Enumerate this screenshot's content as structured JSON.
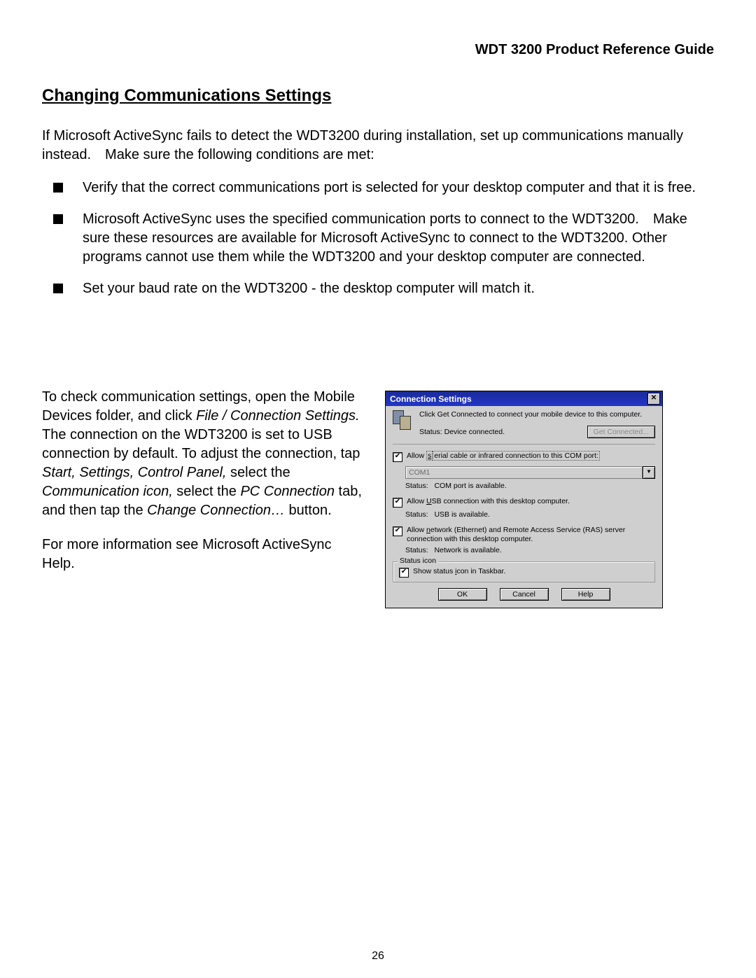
{
  "header": "WDT 3200 Product Reference Guide",
  "title": "Changing Communications Settings",
  "intro": "If Microsoft ActiveSync fails to detect the WDT3200 during installation, set up communications manually instead. Make sure the following conditions are met:",
  "bullets": [
    "Verify that the correct communications port is selected for your desktop computer and that it is free.",
    "Microsoft ActiveSync uses the specified communication ports to connect to the WDT3200. Make sure these resources are available for Microsoft ActiveSync to connect to the WDT3200. Other programs cannot use them while the WDT3200 and your desktop computer are connected.",
    "Set your baud rate on the WDT3200 - the desktop computer will match it."
  ],
  "left": {
    "p1_a": "To check communication settings, open the Mobile Devices folder, and click ",
    "p1_i1": "File / Connection Settings.",
    "p1_b": " The connection on the WDT3200 is set to USB connection by default. To adjust the connection, tap ",
    "p1_i2": "Start, Settings, Control Panel,",
    "p1_c": " select the ",
    "p1_i3": "Communication icon,",
    "p1_d": " select the ",
    "p1_i4": "PC Connection",
    "p1_e": " tab, and then tap the ",
    "p1_i5": "Change Connection…",
    "p1_f": " button.",
    "p2": "For more information see Microsoft ActiveSync Help."
  },
  "dialog": {
    "title": "Connection Settings",
    "close": "✕",
    "instr": "Click Get Connected to connect your mobile device to this computer.",
    "top_status_label": "Status:",
    "top_status_value": "Device connected.",
    "get_connected": "Get Connected...",
    "serial_a": "Allow ",
    "serial_u": "s",
    "serial_b": "erial cable or infrared connection to this COM port:",
    "com_value": "COM1",
    "com_status_label": "Status:",
    "com_status_value": "COM port is available.",
    "usb_a": "Allow ",
    "usb_u": "U",
    "usb_b": "SB connection with this desktop computer.",
    "usb_status_label": "Status:",
    "usb_status_value": "USB is available.",
    "net_a": "Allow ",
    "net_u": "n",
    "net_b": "etwork (Ethernet) and Remote Access Service (RAS) server connection with this desktop computer.",
    "net_status_label": "Status:",
    "net_status_value": "Network is available.",
    "group_legend": "Status icon",
    "show_a": "Show status ",
    "show_u": "i",
    "show_b": "con in Taskbar.",
    "btn_ok": "OK",
    "btn_cancel": "Cancel",
    "btn_help": "Help"
  },
  "page_number": "26"
}
